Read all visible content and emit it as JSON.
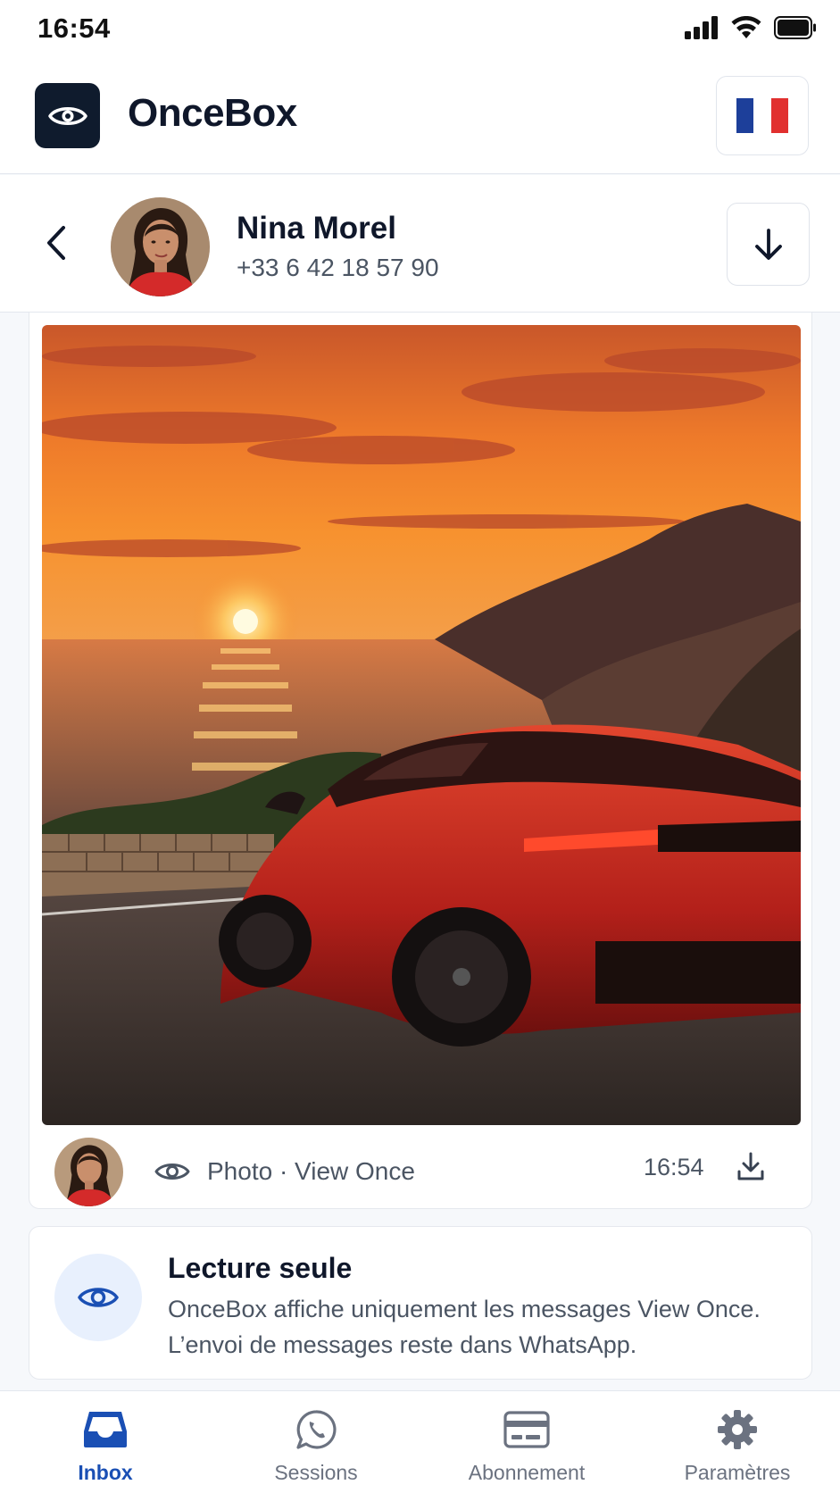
{
  "status_bar": {
    "time": "16:54"
  },
  "header": {
    "app_name": "OnceBox",
    "language": "French flag"
  },
  "contact": {
    "name": "Nina Morel",
    "phone": "+33 6 42 18 57 90"
  },
  "message": {
    "media_label": "Photo · View Once",
    "time": "16:54"
  },
  "info": {
    "title": "Lecture seule",
    "body": "OnceBox affiche uniquement les messages View Once. L’envoi de messages reste dans WhatsApp."
  },
  "nav": {
    "items": [
      {
        "label": "Inbox",
        "icon": "inbox-icon",
        "active": true
      },
      {
        "label": "Sessions",
        "icon": "whatsapp-icon",
        "active": false
      },
      {
        "label": "Abonnement",
        "icon": "credit-card-icon",
        "active": false
      },
      {
        "label": "Paramètres",
        "icon": "gear-icon",
        "active": false
      }
    ]
  },
  "colors": {
    "accent": "#1a4fb4",
    "logo_bg": "#0f1b2d",
    "info_icon_bg": "#e8f0fd",
    "flag_blue": "#1d3f9a",
    "flag_white": "#ffffff",
    "flag_red": "#e1302f"
  }
}
